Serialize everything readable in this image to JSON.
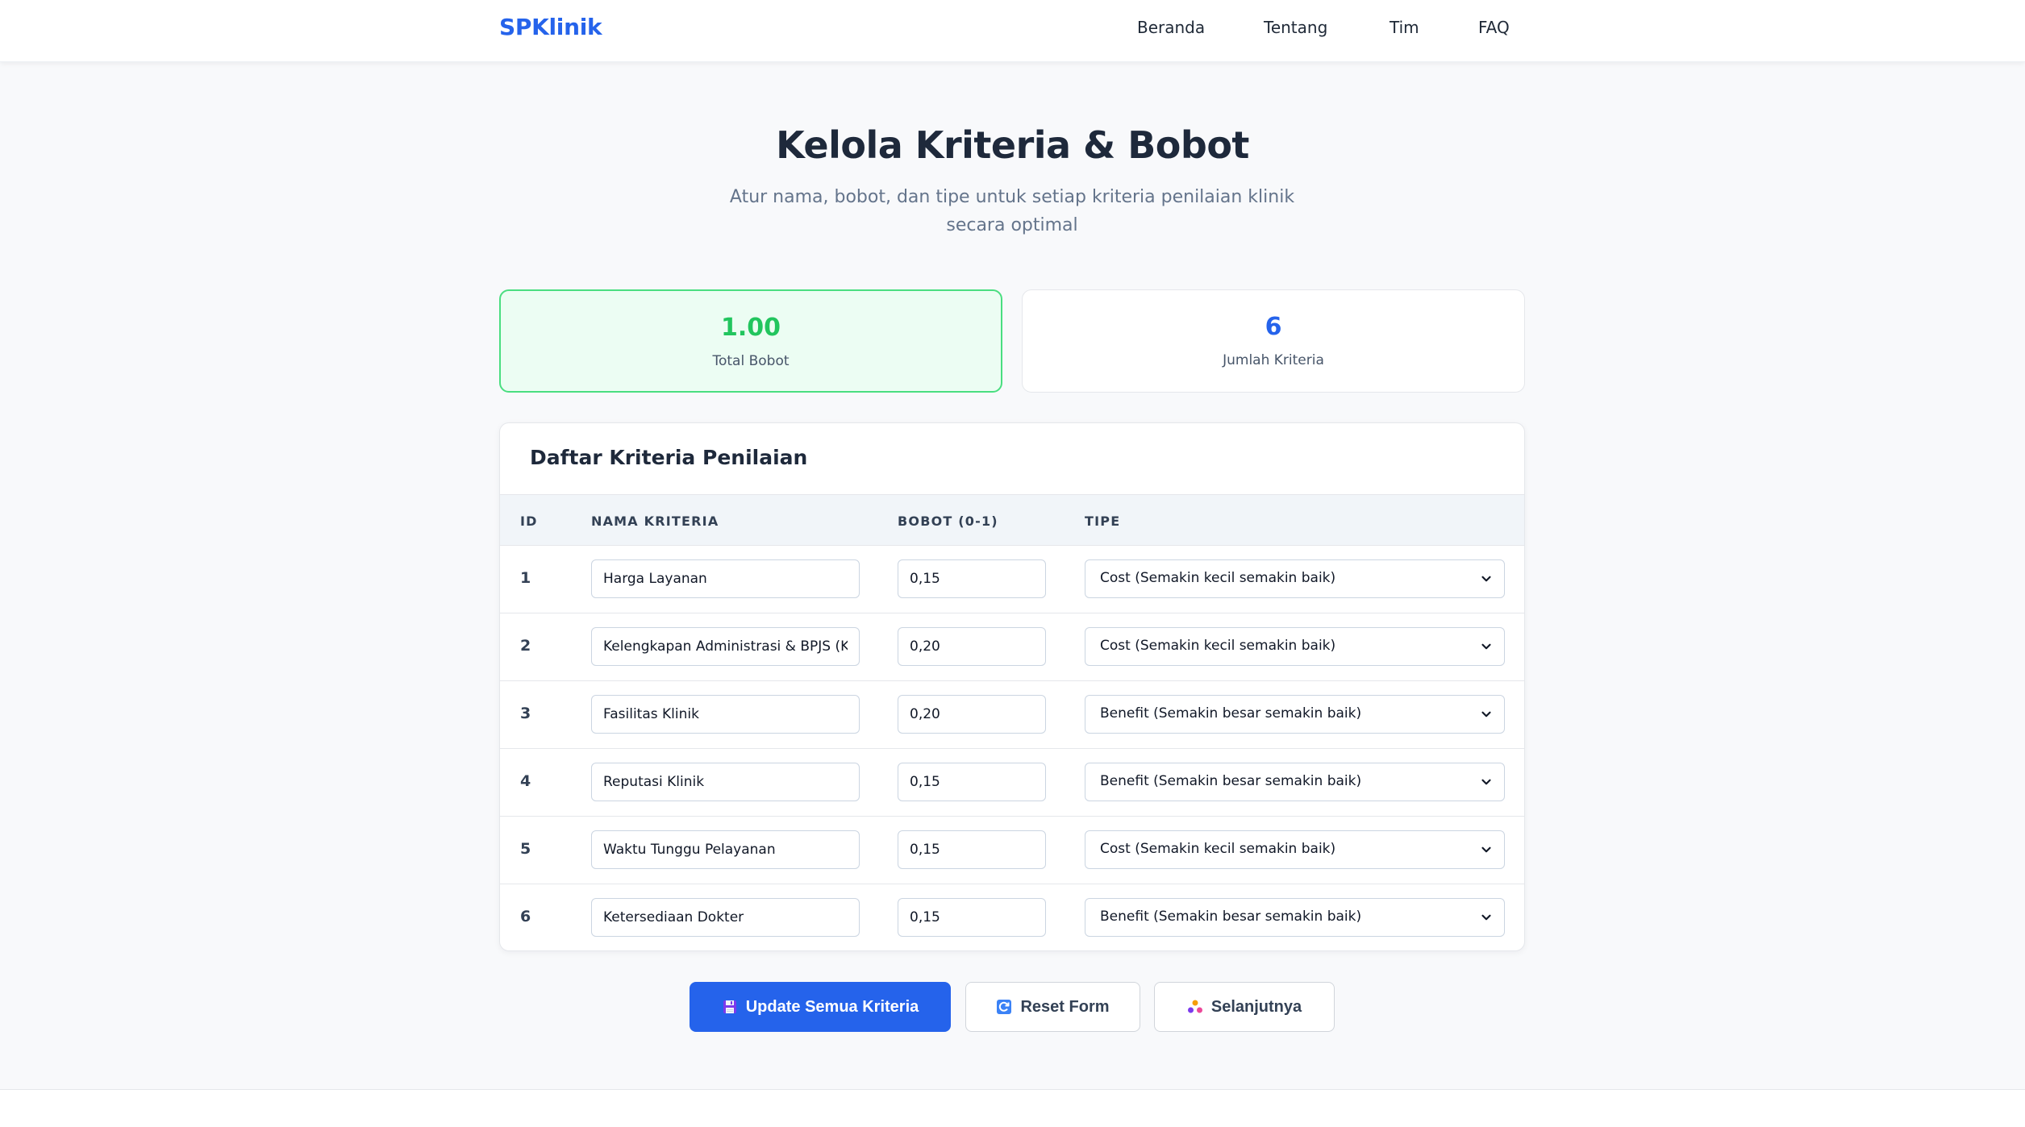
{
  "nav": {
    "brand": "SPKlinik",
    "links": [
      "Beranda",
      "Tentang",
      "Tim",
      "FAQ"
    ]
  },
  "header": {
    "title": "Kelola Kriteria & Bobot",
    "subtitle": "Atur nama, bobot, dan tipe untuk setiap kriteria penilaian klinik secara optimal"
  },
  "stats": {
    "total_value": "1.00",
    "total_label": "Total Bobot",
    "count_value": "6",
    "count_label": "Jumlah Kriteria"
  },
  "table": {
    "heading": "Daftar Kriteria Penilaian",
    "columns": [
      "ID",
      "NAMA KRITERIA",
      "BOBOT (0-1)",
      "TIPE"
    ],
    "rows": [
      {
        "id": "1",
        "name": "Harga Layanan",
        "weight": "0,15",
        "type": "Cost (Semakin kecil semakin baik)"
      },
      {
        "id": "2",
        "name": "Kelengkapan Administrasi & BPJS (K",
        "weight": "0,20",
        "type": "Cost (Semakin kecil semakin baik)"
      },
      {
        "id": "3",
        "name": "Fasilitas Klinik",
        "weight": "0,20",
        "type": "Benefit (Semakin besar semakin baik)"
      },
      {
        "id": "4",
        "name": "Reputasi Klinik",
        "weight": "0,15",
        "type": "Benefit (Semakin besar semakin baik)"
      },
      {
        "id": "5",
        "name": "Waktu Tunggu Pelayanan",
        "weight": "0,15",
        "type": "Cost (Semakin kecil semakin baik)"
      },
      {
        "id": "6",
        "name": "Ketersediaan Dokter",
        "weight": "0,15",
        "type": "Benefit (Semakin besar semakin baik)"
      }
    ]
  },
  "actions": {
    "update_label": "Update Semua Kriteria",
    "update_icon": "floppy-disk-icon",
    "reset_label": "Reset Form",
    "reset_icon": "refresh-icon",
    "next_label": "Selanjutnya",
    "next_icon": "people-icon"
  },
  "colors": {
    "brand": "#2563eb",
    "total_value": "#22c55e",
    "count_value": "#2563eb",
    "total_card_bg": "#ecfdf3",
    "total_card_border": "#4ade80"
  }
}
